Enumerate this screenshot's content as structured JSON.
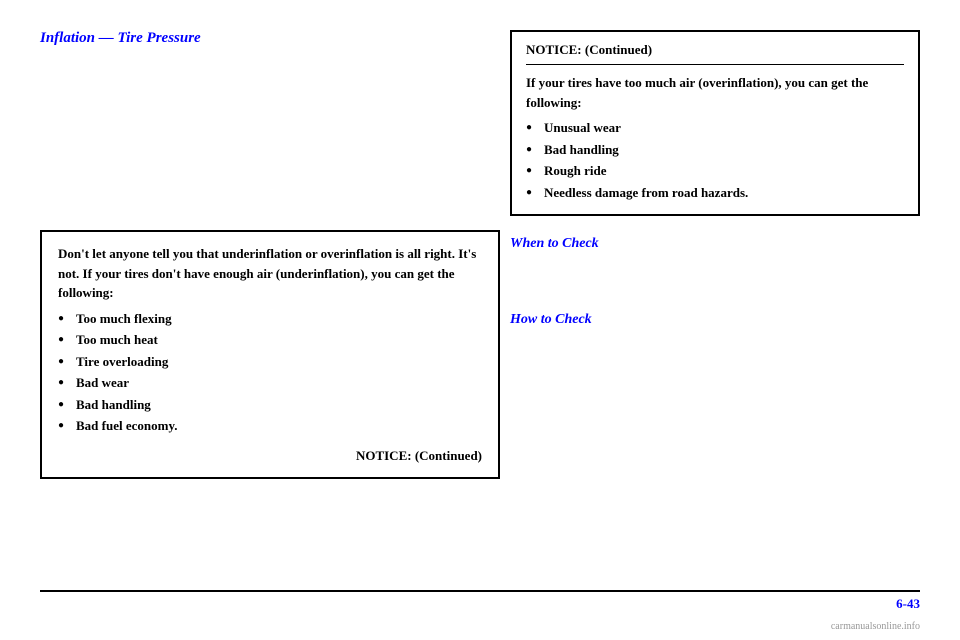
{
  "page": {
    "title": "Inflation — Tire Pressure",
    "page_number": "6-43"
  },
  "right_notice": {
    "title": "NOTICE: (Continued)",
    "intro": "If your tires have too much air (overinflation), you can get the following:",
    "items": [
      "Unusual wear",
      "Bad handling",
      "Rough ride",
      "Needless damage from road hazards."
    ]
  },
  "left_notice": {
    "intro": "Don't let anyone tell you that underinflation or overinflation is all right. It's not. If your tires don't have enough air (underinflation), you can get the following:",
    "items": [
      "Too much flexing",
      "Too much heat",
      "Tire overloading",
      "Bad wear",
      "Bad handling",
      "Bad fuel economy."
    ],
    "continued": "NOTICE: (Continued)"
  },
  "sections": {
    "when_to_check": {
      "heading": "When to Check"
    },
    "how_to_check": {
      "heading": "How to Check"
    }
  },
  "watermark": "carmanualsonline.info"
}
